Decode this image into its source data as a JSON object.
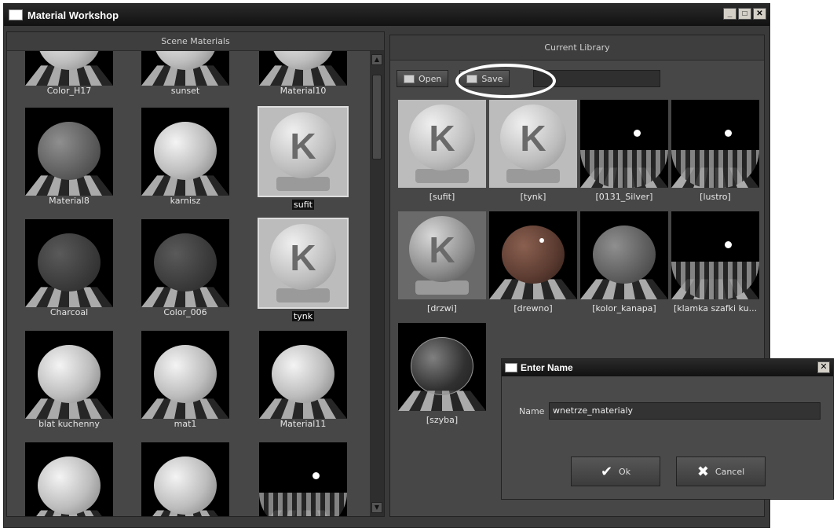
{
  "window": {
    "title": "Material Workshop",
    "min_label": "_",
    "max_label": "□",
    "close_label": "✕"
  },
  "scene": {
    "header": "Scene Materials",
    "items": [
      {
        "label": "Color_H17",
        "look": "white"
      },
      {
        "label": "sunset",
        "look": "white"
      },
      {
        "label": "Material10",
        "look": "white"
      },
      {
        "label": "Material8",
        "look": "grey"
      },
      {
        "label": "karnisz",
        "look": "white"
      },
      {
        "label": "sufit",
        "look": "k",
        "selected": true
      },
      {
        "label": "Charcoal",
        "look": "dark"
      },
      {
        "label": "Color_006",
        "look": "dark"
      },
      {
        "label": "tynk",
        "look": "k",
        "selected": true
      },
      {
        "label": "blat kuchenny",
        "look": "white"
      },
      {
        "label": "mat1",
        "look": "white"
      },
      {
        "label": "Material11",
        "look": "white"
      },
      {
        "label": "",
        "look": "white"
      },
      {
        "label": "",
        "look": "white"
      },
      {
        "label": "",
        "look": "chrome"
      }
    ]
  },
  "library": {
    "header": "Current Library",
    "open_label": "Open",
    "save_label": "Save",
    "items": [
      {
        "label": "[sufit]",
        "look": "k"
      },
      {
        "label": "[tynk]",
        "look": "k"
      },
      {
        "label": "[0131_Silver]",
        "look": "chrome"
      },
      {
        "label": "[lustro]",
        "look": "chrome"
      },
      {
        "label": "[drzwi]",
        "look": "glassk"
      },
      {
        "label": "[drewno]",
        "look": "red"
      },
      {
        "label": "[kolor_kanapa]",
        "look": "grey"
      },
      {
        "label": "[klamka szafki ku...",
        "look": "chrome"
      },
      {
        "label": "[szyba]",
        "look": "glass"
      }
    ]
  },
  "dialog": {
    "title": "Enter Name",
    "close_label": "✕",
    "name_label": "Name",
    "name_value": "wnetrze_materialy",
    "ok_label": "Ok",
    "cancel_label": "Cancel"
  }
}
